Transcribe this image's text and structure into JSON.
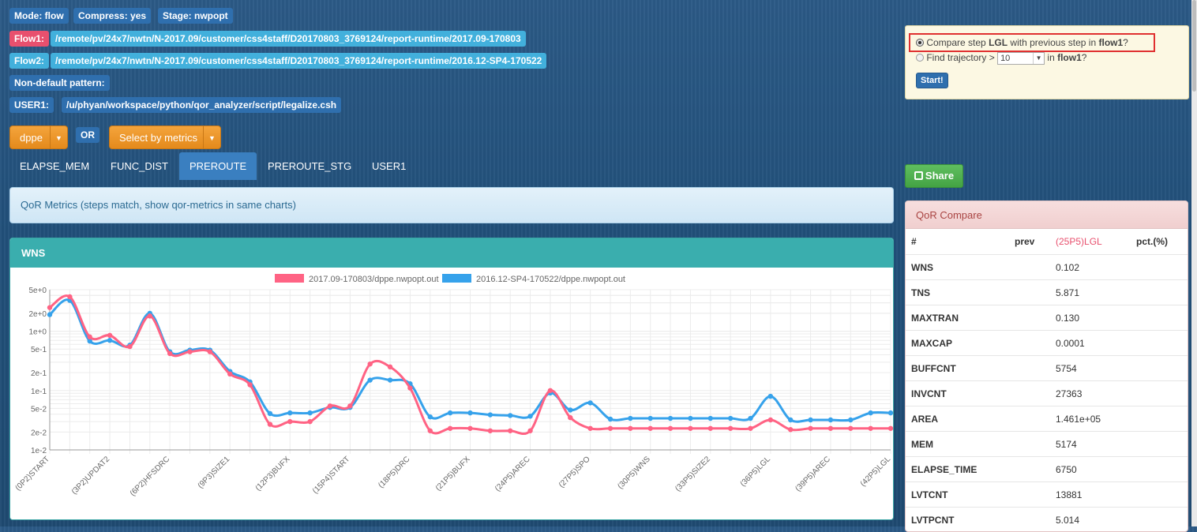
{
  "header": {
    "mode": "Mode: flow",
    "compress": "Compress: yes",
    "stage": "Stage: nwpopt",
    "flow1_label": "Flow1:",
    "flow1_path": "/remote/pv/24x7/nwtn/N-2017.09/customer/css4staff/D20170803_3769124/report-runtime/2017.09-170803",
    "flow2_label": "Flow2:",
    "flow2_path": "/remote/pv/24x7/nwtn/N-2017.09/customer/css4staff/D20170803_3769124/report-runtime/2016.12-SP4-170522",
    "nondefault_label": "Non-default pattern:",
    "user1_label": "USER1:",
    "user1_path": "/u/phyan/workspace/python/qor_analyzer/script/legalize.csh"
  },
  "controls": {
    "dropdown1": "dppe",
    "or_label": "OR",
    "dropdown2": "Select by metrics"
  },
  "tabs": [
    {
      "label": "ELAPSE_MEM"
    },
    {
      "label": "FUNC_DIST"
    },
    {
      "label": "PREROUTE",
      "active": true
    },
    {
      "label": "PREROUTE_STG"
    },
    {
      "label": "USER1"
    }
  ],
  "info_text": "QoR Metrics (steps match, show qor-metrics in same charts)",
  "panel_title": "WNS",
  "trajectory": {
    "opt1_pre": "Compare step",
    "opt1_step": "LGL",
    "opt1_mid": "with previous step in",
    "opt1_flow": "flow1",
    "opt1_end": "?",
    "opt2_pre": "Find trajectory >",
    "opt2_value": "10",
    "opt2_mid": "in",
    "opt2_flow": "flow1",
    "opt2_end": "?",
    "start_button": "Start!"
  },
  "share_label": "Share",
  "qor_compare": {
    "title": "QoR Compare",
    "columns": [
      "#",
      "prev",
      "(25P5)LGL",
      "pct.(%)"
    ],
    "rows": [
      {
        "name": "WNS",
        "prev": "",
        "cur": "0.102",
        "pct": ""
      },
      {
        "name": "TNS",
        "prev": "",
        "cur": "5.871",
        "pct": ""
      },
      {
        "name": "MAXTRAN",
        "prev": "",
        "cur": "0.130",
        "pct": ""
      },
      {
        "name": "MAXCAP",
        "prev": "",
        "cur": "0.0001",
        "pct": ""
      },
      {
        "name": "BUFFCNT",
        "prev": "",
        "cur": "5754",
        "pct": ""
      },
      {
        "name": "INVCNT",
        "prev": "",
        "cur": "27363",
        "pct": ""
      },
      {
        "name": "AREA",
        "prev": "",
        "cur": "1.461e+05",
        "pct": ""
      },
      {
        "name": "MEM",
        "prev": "",
        "cur": "5174",
        "pct": ""
      },
      {
        "name": "ELAPSE_TIME",
        "prev": "",
        "cur": "6750",
        "pct": ""
      },
      {
        "name": "LVTCNT",
        "prev": "",
        "cur": "13881",
        "pct": ""
      },
      {
        "name": "LVTPCNT",
        "prev": "",
        "cur": "5.014",
        "pct": ""
      }
    ]
  },
  "colors": {
    "flow1": "#ff6384",
    "flow2": "#36a2eb"
  },
  "chart_data": {
    "type": "line",
    "yscale": "log",
    "ylim": [
      0.01,
      5
    ],
    "y_ticks": [
      "5e+0",
      "2e+0",
      "1e+0",
      "5e-1",
      "2e-1",
      "1e-1",
      "5e-2",
      "2e-2",
      "1e-2"
    ],
    "y_tick_values": [
      5,
      2,
      1,
      0.5,
      0.2,
      0.1,
      0.05,
      0.02,
      0.01
    ],
    "x_tick_labels": [
      "(0P2)START",
      "(3P2)UPDAT2",
      "(6P2)HFSDRC",
      "(9P3)SIZE1",
      "(12P3)BUFX",
      "(15P4)START",
      "(18P5)DRC",
      "(21P5)BUFX",
      "(24P5)AREC",
      "(27P5)SPO",
      "(30P5)WNS",
      "(33P5)SIZE2",
      "(36P5)LGL",
      "(39P5)AREC",
      "(42P5)LGL"
    ],
    "grid": true,
    "legend_position": "top",
    "series": [
      {
        "name": "2017.09-170803/dppe.nwpopt.out",
        "color": "#ff6384",
        "values": [
          2.5,
          3.8,
          0.8,
          0.85,
          0.55,
          1.8,
          0.42,
          0.45,
          0.45,
          0.19,
          0.125,
          0.027,
          0.03,
          0.03,
          0.055,
          0.055,
          0.28,
          0.25,
          0.11,
          0.021,
          0.023,
          0.023,
          0.021,
          0.021,
          0.021,
          0.1,
          0.035,
          0.023,
          0.023,
          0.023,
          0.023,
          0.023,
          0.023,
          0.023,
          0.023,
          0.023,
          0.032,
          0.022,
          0.023,
          0.023,
          0.023,
          0.023,
          0.023
        ]
      },
      {
        "name": "2016.12-SP4-170522/dppe.nwpopt.out",
        "color": "#36a2eb",
        "values": [
          1.9,
          3.3,
          0.68,
          0.7,
          0.58,
          2.0,
          0.45,
          0.48,
          0.48,
          0.21,
          0.14,
          0.041,
          0.042,
          0.042,
          0.052,
          0.052,
          0.15,
          0.15,
          0.13,
          0.036,
          0.042,
          0.042,
          0.039,
          0.038,
          0.037,
          0.091,
          0.047,
          0.062,
          0.033,
          0.034,
          0.034,
          0.034,
          0.034,
          0.034,
          0.034,
          0.034,
          0.08,
          0.032,
          0.032,
          0.032,
          0.032,
          0.042,
          0.042
        ]
      }
    ]
  }
}
